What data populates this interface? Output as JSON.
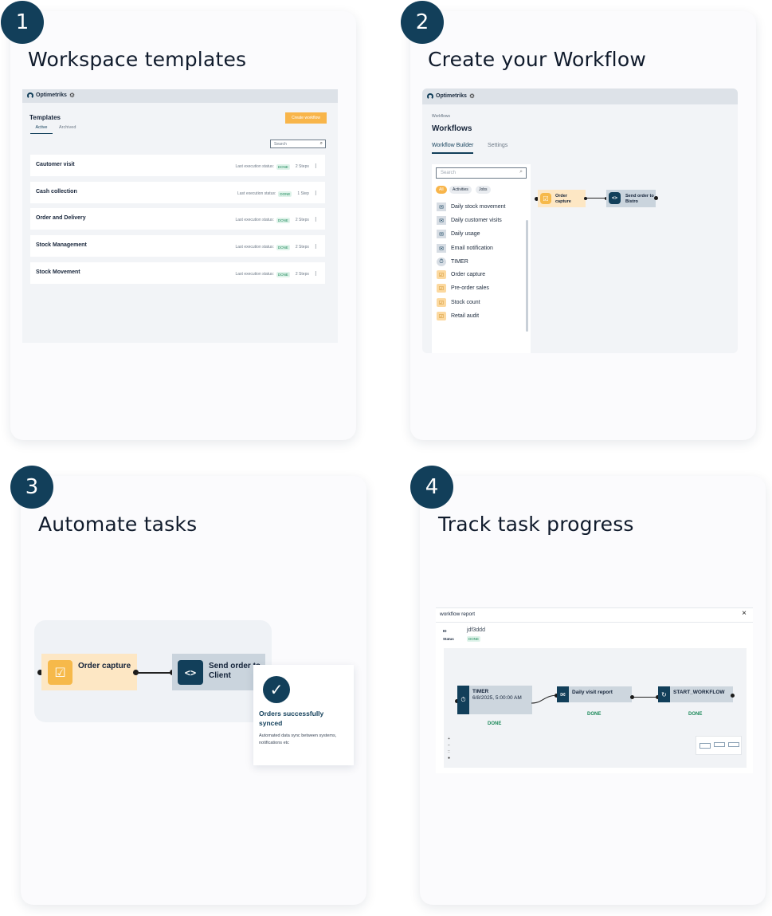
{
  "steps": [
    {
      "number": "1",
      "title": "Workspace templates"
    },
    {
      "number": "2",
      "title": "Create your Workflow"
    },
    {
      "number": "3",
      "title": "Automate tasks"
    },
    {
      "number": "4",
      "title": "Track task progress"
    }
  ],
  "app": {
    "brand": "Optimetriks"
  },
  "templates": {
    "heading": "Templates",
    "tabs": [
      "Active",
      "Archived"
    ],
    "create_button": "Create workflow",
    "search_placeholder": "Search",
    "status_label": "Last execution status:",
    "done": "DONE",
    "rows": [
      {
        "name": "Cautomer visit",
        "steps": "2 Steps"
      },
      {
        "name": "Cash collection",
        "steps": "1 Step"
      },
      {
        "name": "Order and Delivery",
        "steps": "2 Steps"
      },
      {
        "name": "Stock Management",
        "steps": "2 Steps"
      },
      {
        "name": "Stock Movement",
        "steps": "2 Steps"
      }
    ]
  },
  "workflows": {
    "breadcrumb": "Workflows",
    "heading": "Workflows",
    "tabs": [
      "Workflow Builder",
      "Settings"
    ],
    "search_placeholder": "Search",
    "filters": [
      "All",
      "Activities",
      "Jobs"
    ],
    "activities": [
      {
        "label": "Daily stock movement",
        "icon": "mail-icon"
      },
      {
        "label": "Daily customer visits",
        "icon": "mail-icon"
      },
      {
        "label": "Daily usage",
        "icon": "mail-icon"
      },
      {
        "label": "Email notification",
        "icon": "mail-icon"
      },
      {
        "label": "TIMER",
        "icon": "timer-icon"
      },
      {
        "label": "Order capture",
        "icon": "form-icon"
      },
      {
        "label": "Pre-order sales",
        "icon": "form-icon"
      },
      {
        "label": "Stock count",
        "icon": "form-icon"
      },
      {
        "label": "Retail audit",
        "icon": "form-icon"
      }
    ],
    "canvas_nodes": [
      "Order capture",
      "Send order to Bistro"
    ]
  },
  "automate": {
    "node_form": "Order capture",
    "node_code": "Send order to Client",
    "success_title": "Orders successfully synced",
    "success_text": "Automated data sync between systems, notifications etc"
  },
  "report": {
    "title": "workflow report",
    "close": "×",
    "id_label": "ID",
    "id_value": "jdf3ddd",
    "status_label": "Status",
    "status_value": "DONE",
    "nodes": [
      {
        "title": "TIMER",
        "detail": "6/8/2025, 5:00:00 AM",
        "status": "DONE"
      },
      {
        "title": "Daily visit report",
        "status": "DONE"
      },
      {
        "title": "START_WORKFLOW",
        "status": "DONE"
      }
    ],
    "zoom_controls": [
      "+",
      "−",
      "::",
      "●"
    ]
  },
  "colors": {
    "accent": "#123f5a",
    "orange": "#f6b94a",
    "done_green": "#1e8a5b"
  }
}
